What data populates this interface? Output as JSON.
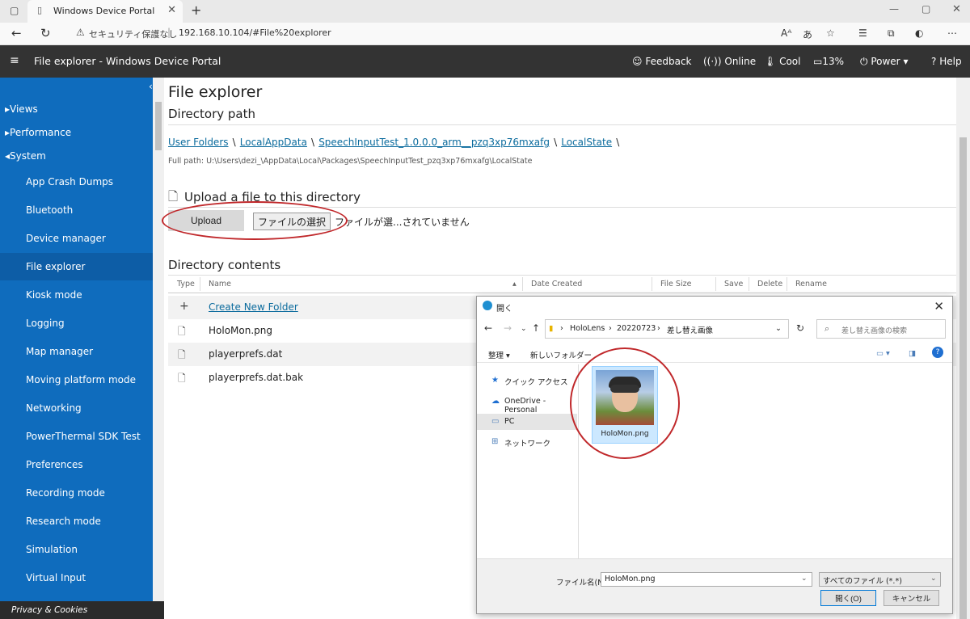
{
  "browser": {
    "tab_title": "Windows Device Portal",
    "url_warning": "セキュリティ保護なし",
    "url": "192.168.10.104/#File%20explorer"
  },
  "header": {
    "title": "File explorer - Windows Device Portal",
    "feedback": "Feedback",
    "online": "Online",
    "cool": "Cool",
    "battery": "13%",
    "power": "Power",
    "help": "Help"
  },
  "sidebar": {
    "sections": [
      "Views",
      "Performance",
      "System"
    ],
    "items": [
      "App Crash Dumps",
      "Bluetooth",
      "Device manager",
      "File explorer",
      "Kiosk mode",
      "Logging",
      "Map manager",
      "Moving platform mode",
      "Networking",
      "PowerThermal SDK Test",
      "Preferences",
      "Recording mode",
      "Research mode",
      "Simulation",
      "Virtual Input"
    ],
    "footer": "Privacy & Cookies"
  },
  "main": {
    "page_title": "File explorer",
    "directory_path_heading": "Directory path",
    "breadcrumbs": [
      "User Folders",
      "LocalAppData",
      "SpeechInputTest_1.0.0.0_arm__pzq3xp76mxafg",
      "LocalState"
    ],
    "full_path": "Full path: U:\\Users\\dezi_\\AppData\\Local\\Packages\\SpeechInputTest_pzq3xp76mxafg\\LocalState",
    "upload_heading": "Upload a file to this directory",
    "upload_button": "Upload",
    "choose_file_button": "ファイルの選択",
    "no_file_text": "ファイルが選...されていません",
    "contents_heading": "Directory contents",
    "columns": [
      "Type",
      "Name",
      "Date Created",
      "File Size",
      "Save",
      "Delete",
      "Rename"
    ],
    "rows": [
      {
        "icon": "+",
        "name": "Create New Folder"
      },
      {
        "icon": "file",
        "name": "HoloMon.png"
      },
      {
        "icon": "file",
        "name": "playerprefs.dat"
      },
      {
        "icon": "file",
        "name": "playerprefs.dat.bak"
      }
    ]
  },
  "dialog": {
    "title": "開く",
    "path": [
      "HoloLens",
      "20220723",
      "差し替え画像"
    ],
    "search_placeholder": "差し替え画像の検索",
    "toolbar": {
      "organize": "整理",
      "new_folder": "新しいフォルダー"
    },
    "nav": [
      "クイック アクセス",
      "OneDrive - Personal",
      "PC",
      "ネットワーク"
    ],
    "file_name": "HoloMon.png",
    "file_name_label": "ファイル名(N):",
    "file_name_value": "HoloMon.png",
    "filter": "すべてのファイル (*.*)",
    "open_button": "開く(O)",
    "cancel_button": "キャンセル"
  }
}
